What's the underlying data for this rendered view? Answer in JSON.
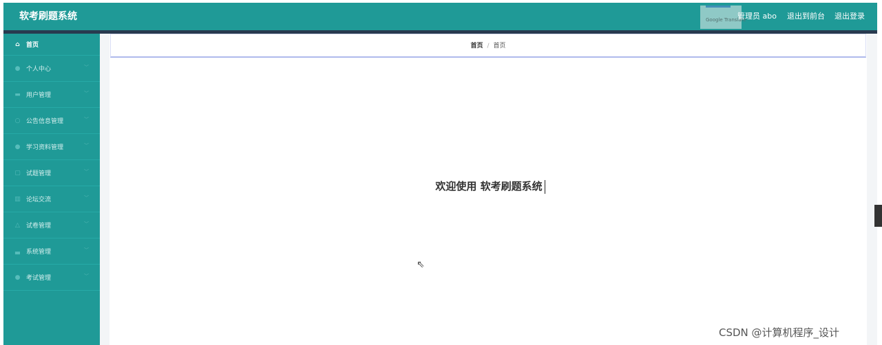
{
  "app": {
    "title": "软考刷题系统"
  },
  "header": {
    "translate_label": "Google Translate",
    "admin_label": "管理员 abo",
    "front_label": "退出到前台",
    "logout_label": "退出登录"
  },
  "sidebar": {
    "items": [
      {
        "label": "首页",
        "icon": "home-icon"
      },
      {
        "label": "个人中心",
        "icon": "user-icon"
      },
      {
        "label": "用户管理",
        "icon": "users-icon"
      },
      {
        "label": "公告信息管理",
        "icon": "bell-icon"
      },
      {
        "label": "学习资料管理",
        "icon": "book-icon"
      },
      {
        "label": "试题管理",
        "icon": "file-icon"
      },
      {
        "label": "论坛交流",
        "icon": "chat-icon"
      },
      {
        "label": "试卷管理",
        "icon": "paper-icon"
      },
      {
        "label": "系统管理",
        "icon": "gear-icon"
      },
      {
        "label": "考试管理",
        "icon": "exam-icon"
      }
    ]
  },
  "breadcrumb": {
    "home": "首页",
    "separator": "/",
    "current": "首页"
  },
  "main": {
    "welcome": "欢迎使用 软考刷题系统"
  },
  "watermark": "CSDN @计算机程序_设计",
  "colors": {
    "primary": "#1f9a97",
    "strip": "#283a4f"
  }
}
